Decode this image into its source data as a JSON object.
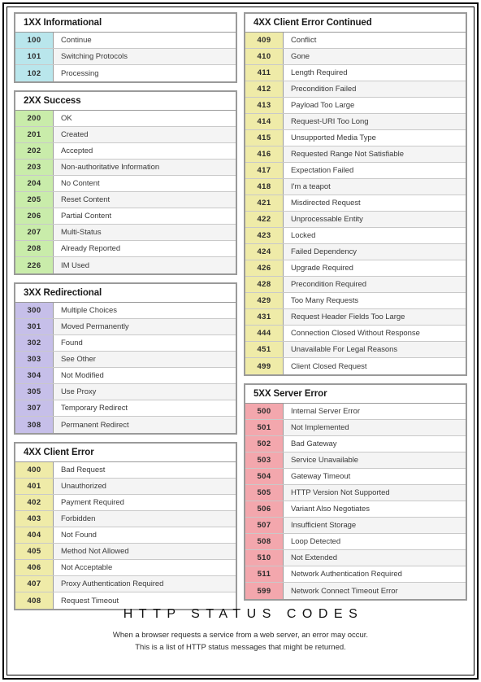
{
  "footer": {
    "title": "HTTP STATUS CODES",
    "line1": "When a browser requests a service from a web server, an error may occur.",
    "line2": "This is a list of HTTP status messages that might be returned."
  },
  "colors": {
    "informational": "#b9e6ec",
    "success": "#c9ecaa",
    "redirectional": "#c6bfe9",
    "client_error": "#efeba8",
    "server_error": "#f3a7ad",
    "box_border": "#9a9a9a",
    "row_border": "#c9c9c9",
    "alt_row": "#f4f4f4",
    "frame": "#000000"
  },
  "left_column": [
    {
      "id": "1xx",
      "title": "1XX Informational",
      "accent": "#b9e6ec",
      "rows": [
        {
          "code": "100",
          "desc": "Continue"
        },
        {
          "code": "101",
          "desc": "Switching Protocols"
        },
        {
          "code": "102",
          "desc": "Processing"
        }
      ]
    },
    {
      "id": "2xx",
      "title": "2XX Success",
      "accent": "#c9ecaa",
      "rows": [
        {
          "code": "200",
          "desc": "OK"
        },
        {
          "code": "201",
          "desc": "Created"
        },
        {
          "code": "202",
          "desc": "Accepted"
        },
        {
          "code": "203",
          "desc": "Non-authoritative Information"
        },
        {
          "code": "204",
          "desc": "No Content"
        },
        {
          "code": "205",
          "desc": "Reset Content"
        },
        {
          "code": "206",
          "desc": "Partial Content"
        },
        {
          "code": "207",
          "desc": "Multi-Status"
        },
        {
          "code": "208",
          "desc": "Already Reported"
        },
        {
          "code": "226",
          "desc": "IM Used"
        }
      ]
    },
    {
      "id": "3xx",
      "title": "3XX Redirectional",
      "accent": "#c6bfe9",
      "rows": [
        {
          "code": "300",
          "desc": "Multiple Choices"
        },
        {
          "code": "301",
          "desc": "Moved Permanently"
        },
        {
          "code": "302",
          "desc": "Found"
        },
        {
          "code": "303",
          "desc": "See Other"
        },
        {
          "code": "304",
          "desc": "Not Modified"
        },
        {
          "code": "305",
          "desc": "Use Proxy"
        },
        {
          "code": "307",
          "desc": "Temporary Redirect"
        },
        {
          "code": "308",
          "desc": "Permanent Redirect"
        }
      ]
    },
    {
      "id": "4xx",
      "title": "4XX Client Error",
      "accent": "#efeba8",
      "rows": [
        {
          "code": "400",
          "desc": "Bad Request"
        },
        {
          "code": "401",
          "desc": "Unauthorized"
        },
        {
          "code": "402",
          "desc": "Payment Required"
        },
        {
          "code": "403",
          "desc": "Forbidden"
        },
        {
          "code": "404",
          "desc": "Not Found"
        },
        {
          "code": "405",
          "desc": "Method Not Allowed"
        },
        {
          "code": "406",
          "desc": "Not Acceptable"
        },
        {
          "code": "407",
          "desc": "Proxy Authentication Required"
        },
        {
          "code": "408",
          "desc": "Request Timeout"
        }
      ]
    }
  ],
  "right_column": [
    {
      "id": "4xx-cont",
      "title": "4XX Client Error Continued",
      "accent": "#efeba8",
      "rows": [
        {
          "code": "409",
          "desc": "Conflict"
        },
        {
          "code": "410",
          "desc": "Gone"
        },
        {
          "code": "411",
          "desc": "Length Required"
        },
        {
          "code": "412",
          "desc": "Precondition Failed"
        },
        {
          "code": "413",
          "desc": "Payload Too Large"
        },
        {
          "code": "414",
          "desc": "Request-URI Too Long"
        },
        {
          "code": "415",
          "desc": "Unsupported Media Type"
        },
        {
          "code": "416",
          "desc": "Requested Range Not Satisfiable"
        },
        {
          "code": "417",
          "desc": "Expectation Failed"
        },
        {
          "code": "418",
          "desc": "I'm a teapot"
        },
        {
          "code": "421",
          "desc": "Misdirected Request"
        },
        {
          "code": "422",
          "desc": "Unprocessable Entity"
        },
        {
          "code": "423",
          "desc": "Locked"
        },
        {
          "code": "424",
          "desc": "Failed Dependency"
        },
        {
          "code": "426",
          "desc": "Upgrade Required"
        },
        {
          "code": "428",
          "desc": "Precondition Required"
        },
        {
          "code": "429",
          "desc": "Too Many Requests"
        },
        {
          "code": "431",
          "desc": "Request Header Fields Too Large"
        },
        {
          "code": "444",
          "desc": "Connection Closed Without Response"
        },
        {
          "code": "451",
          "desc": "Unavailable For Legal Reasons"
        },
        {
          "code": "499",
          "desc": "Client Closed Request"
        }
      ]
    },
    {
      "id": "5xx",
      "title": "5XX Server Error",
      "accent": "#f3a7ad",
      "rows": [
        {
          "code": "500",
          "desc": "Internal Server Error"
        },
        {
          "code": "501",
          "desc": "Not Implemented"
        },
        {
          "code": "502",
          "desc": "Bad Gateway"
        },
        {
          "code": "503",
          "desc": "Service Unavailable"
        },
        {
          "code": "504",
          "desc": "Gateway Timeout"
        },
        {
          "code": "505",
          "desc": "HTTP Version Not Supported"
        },
        {
          "code": "506",
          "desc": "Variant Also Negotiates"
        },
        {
          "code": "507",
          "desc": "Insufficient Storage"
        },
        {
          "code": "508",
          "desc": "Loop Detected"
        },
        {
          "code": "510",
          "desc": "Not Extended"
        },
        {
          "code": "511",
          "desc": "Network Authentication Required"
        },
        {
          "code": "599",
          "desc": "Network Connect Timeout Error"
        }
      ]
    }
  ]
}
